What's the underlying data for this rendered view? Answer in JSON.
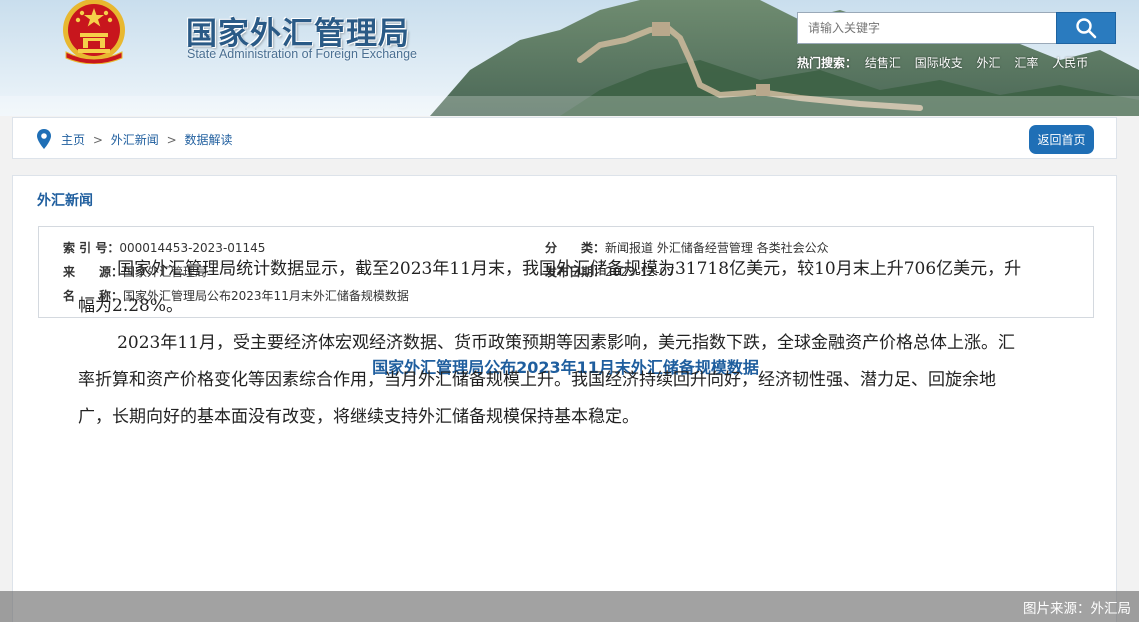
{
  "header": {
    "title": "国家外汇管理局",
    "subtitle": "State Administration of Foreign Exchange",
    "search_placeholder": "请输入关键字",
    "hot_search_label": "热门搜索：",
    "hot_search_items": [
      "结售汇",
      "国际收支",
      "外汇",
      "汇率",
      "人民币"
    ]
  },
  "breadcrumb": {
    "items": [
      "主页",
      "外汇新闻",
      "数据解读"
    ],
    "separator": ">",
    "home_button": "返回首页"
  },
  "section_title": "外汇新闻",
  "meta": {
    "index_label": "索 引 号：",
    "index_value": "000014453-2023-01145",
    "source_label": "来　　源：",
    "source_value": "国家外汇管理局",
    "name_label": "名　　称：",
    "name_value": "国家外汇管理局公布2023年11月末外汇储备规模数据",
    "category_label": "分　　类：",
    "category_value": "新闻报道  外汇储备经营管理  各类社会公众",
    "date_label": "发布日期：",
    "date_value": "2023-12-07"
  },
  "article": {
    "title": "国家外汇管理局公布2023年11月末外汇储备规模数据",
    "paragraphs": [
      "国家外汇管理局统计数据显示，截至2023年11月末，我国外汇储备规模为31718亿美元，较10月末上升706亿美元，升幅为2.28%。",
      "2023年11月，受主要经济体宏观经济数据、货币政策预期等因素影响，美元指数下跌，全球金融资产价格总体上涨。汇率折算和资产价格变化等因素综合作用，当月外汇储备规模上升。我国经济持续回升向好，经济韧性强、潜力足、回旋余地广，长期向好的基本面没有改变，将继续支持外汇储备规模保持基本稳定。"
    ]
  },
  "image_credit": "图片来源：外汇局",
  "colors": {
    "brand_blue": "#1f5e9e",
    "button_blue": "#1f6fb6",
    "search_button": "#2a7bbf",
    "emblem_red": "#c8161d",
    "emblem_gold": "#e8b830"
  }
}
